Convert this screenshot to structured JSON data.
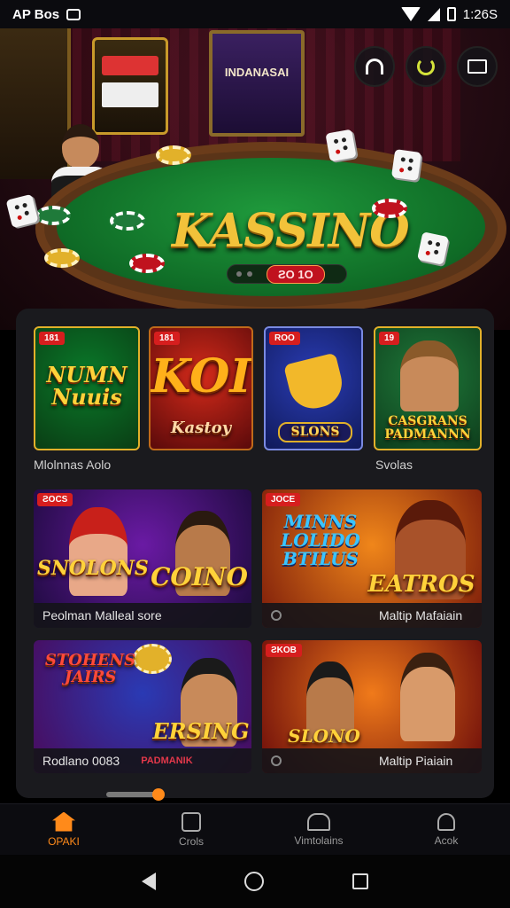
{
  "status_bar": {
    "app_label": "AP Bos",
    "time": "1:26S"
  },
  "hero": {
    "banner_text": "INDANASAI",
    "logo": "KASSINO",
    "bet_value": "ƧO 1O"
  },
  "sections": {
    "row1_left_label": "Mlolnnas Aolo",
    "row1_right_label": "Svolas"
  },
  "games_row1": [
    {
      "badge": "181",
      "title": "NUMN Nuuis",
      "colors": [
        "#0a7a2a",
        "#0a3d14"
      ]
    },
    {
      "badge": "181",
      "title": "KOI",
      "subtitle": "Kastoy",
      "colors": [
        "#d42a1a",
        "#5a0a0a"
      ]
    },
    {
      "badge": "ROO",
      "title": "SLONS",
      "colors": [
        "#2a3cb4",
        "#101a5a"
      ]
    },
    {
      "badge": "19",
      "title": "CASGRANS PADMANNN",
      "colors": [
        "#1f7a3a",
        "#0e3d1c"
      ]
    }
  ],
  "games_row2": [
    {
      "badge": "ƧOCS",
      "title": "SNOLONS",
      "subtitle": "COINO",
      "caption": "Peolman Malleal sore",
      "colors": [
        "#6a1aa4",
        "#1c0a3c"
      ]
    },
    {
      "badge": "JOCE",
      "title": "MINNS LOLIDO BTILUS",
      "subtitle": "EATROS",
      "caption": "Maltip Mafaiain",
      "colors": [
        "#f0861a",
        "#7a1a0a"
      ]
    }
  ],
  "games_row3": [
    {
      "title": "STOHENS JAIRS",
      "subtitle": "ERSING",
      "caption": "Rodlano 0083",
      "tag": "PADMANIK",
      "colors": [
        "#2a3ab4",
        "#4a0a5a"
      ]
    },
    {
      "badge": "ƧKOB",
      "title": "SLONO",
      "caption": "Maltip Piaiain",
      "colors": [
        "#f07a1a",
        "#6a0a0a"
      ]
    }
  ],
  "tabs": [
    {
      "label": "OPAKI",
      "icon": "home-icon",
      "active": true
    },
    {
      "label": "Crols",
      "icon": "box-icon",
      "active": false
    },
    {
      "label": "Vimtolains",
      "icon": "gift-icon",
      "active": false
    },
    {
      "label": "Acok",
      "icon": "bell-icon",
      "active": false
    }
  ],
  "colors": {
    "accent": "#ff8a1a",
    "panel": "#1a1a1e",
    "felt": "#1f9a3c",
    "gold": "#f2c23a"
  }
}
